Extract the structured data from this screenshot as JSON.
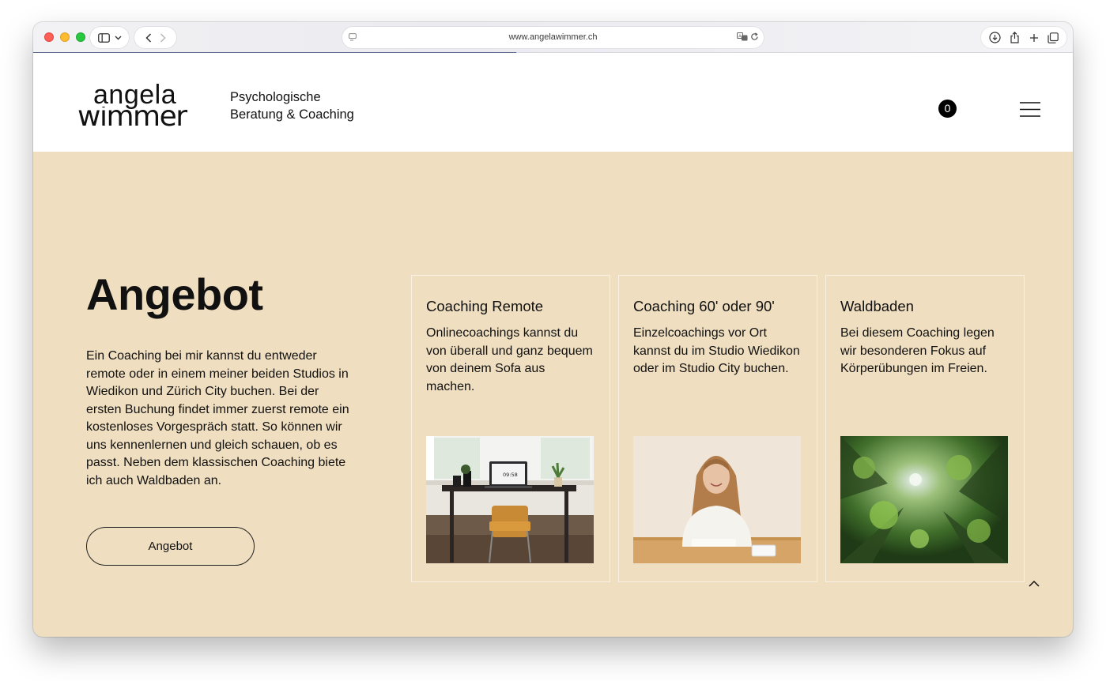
{
  "browser": {
    "url": "www.angelawimmer.ch"
  },
  "header": {
    "logo_top": "angela",
    "logo_bottom": "wimmer",
    "tagline_line1": "Psychologische",
    "tagline_line2": "Beratung & Coaching",
    "cart_count": "0"
  },
  "main": {
    "title": "Angebot",
    "intro": "Ein Coaching bei mir kannst du entweder remote oder in einem meiner beiden Studios in Wiedikon und Zürich City buchen. Bei der ersten Buchung findet immer zuerst remote ein kostenloses Vorgespräch statt. So können wir uns kennenlernen und gleich schauen, ob es passt. Neben dem klassischen Coaching biete ich auch Waldbaden an.",
    "cta_label": "Angebot"
  },
  "cards": [
    {
      "title": "Coaching Remote",
      "text": "Onlinecoachings kannst du von überall und ganz bequem von deinem Sofa aus machen.",
      "image_clock": "09:58"
    },
    {
      "title": "Coaching 60' oder 90'",
      "text": "Einzelcoachings vor Ort kannst du im Studio Wiedikon oder im Studio City buchen."
    },
    {
      "title": "Waldbaden",
      "text": "Bei diesem Coaching legen wir besonderen Fokus auf Körperübungen im Freien."
    }
  ],
  "colors": {
    "page_background": "#efdebf",
    "header_background": "#ffffff",
    "text": "#111111",
    "badge": "#000000"
  },
  "icons": [
    "sidebar-icon",
    "chevron-down-icon",
    "back-icon",
    "forward-icon",
    "site-icon",
    "translate-icon",
    "reload-icon",
    "download-icon",
    "share-icon",
    "new-tab-icon",
    "tabs-overview-icon",
    "menu-icon",
    "chevron-up-icon"
  ]
}
